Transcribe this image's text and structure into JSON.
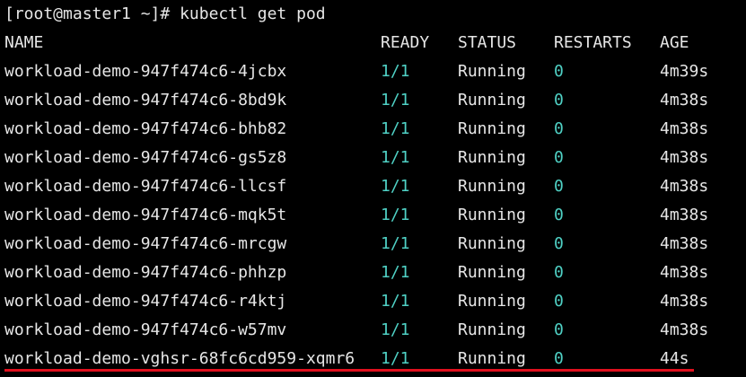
{
  "terminal": {
    "prompt": "[root@master1 ~]# kubectl get pod",
    "accent_color": "#4fd1c5",
    "highlight_color": "#e0101e",
    "columns": [
      "NAME",
      "READY",
      "STATUS",
      "RESTARTS",
      "AGE"
    ],
    "rows": [
      {
        "name": "workload-demo-947f474c6-4jcbx",
        "ready": "1/1",
        "status": "Running",
        "restarts": "0",
        "age": "4m39s"
      },
      {
        "name": "workload-demo-947f474c6-8bd9k",
        "ready": "1/1",
        "status": "Running",
        "restarts": "0",
        "age": "4m38s"
      },
      {
        "name": "workload-demo-947f474c6-bhb82",
        "ready": "1/1",
        "status": "Running",
        "restarts": "0",
        "age": "4m38s"
      },
      {
        "name": "workload-demo-947f474c6-gs5z8",
        "ready": "1/1",
        "status": "Running",
        "restarts": "0",
        "age": "4m38s"
      },
      {
        "name": "workload-demo-947f474c6-llcsf",
        "ready": "1/1",
        "status": "Running",
        "restarts": "0",
        "age": "4m38s"
      },
      {
        "name": "workload-demo-947f474c6-mqk5t",
        "ready": "1/1",
        "status": "Running",
        "restarts": "0",
        "age": "4m38s"
      },
      {
        "name": "workload-demo-947f474c6-mrcgw",
        "ready": "1/1",
        "status": "Running",
        "restarts": "0",
        "age": "4m38s"
      },
      {
        "name": "workload-demo-947f474c6-phhzp",
        "ready": "1/1",
        "status": "Running",
        "restarts": "0",
        "age": "4m38s"
      },
      {
        "name": "workload-demo-947f474c6-r4ktj",
        "ready": "1/1",
        "status": "Running",
        "restarts": "0",
        "age": "4m38s"
      },
      {
        "name": "workload-demo-947f474c6-w57mv",
        "ready": "1/1",
        "status": "Running",
        "restarts": "0",
        "age": "4m38s"
      },
      {
        "name": "workload-demo-vghsr-68fc6cd959-xqmr6",
        "ready": "1/1",
        "status": "Running",
        "restarts": "0",
        "age": "44s"
      }
    ]
  }
}
